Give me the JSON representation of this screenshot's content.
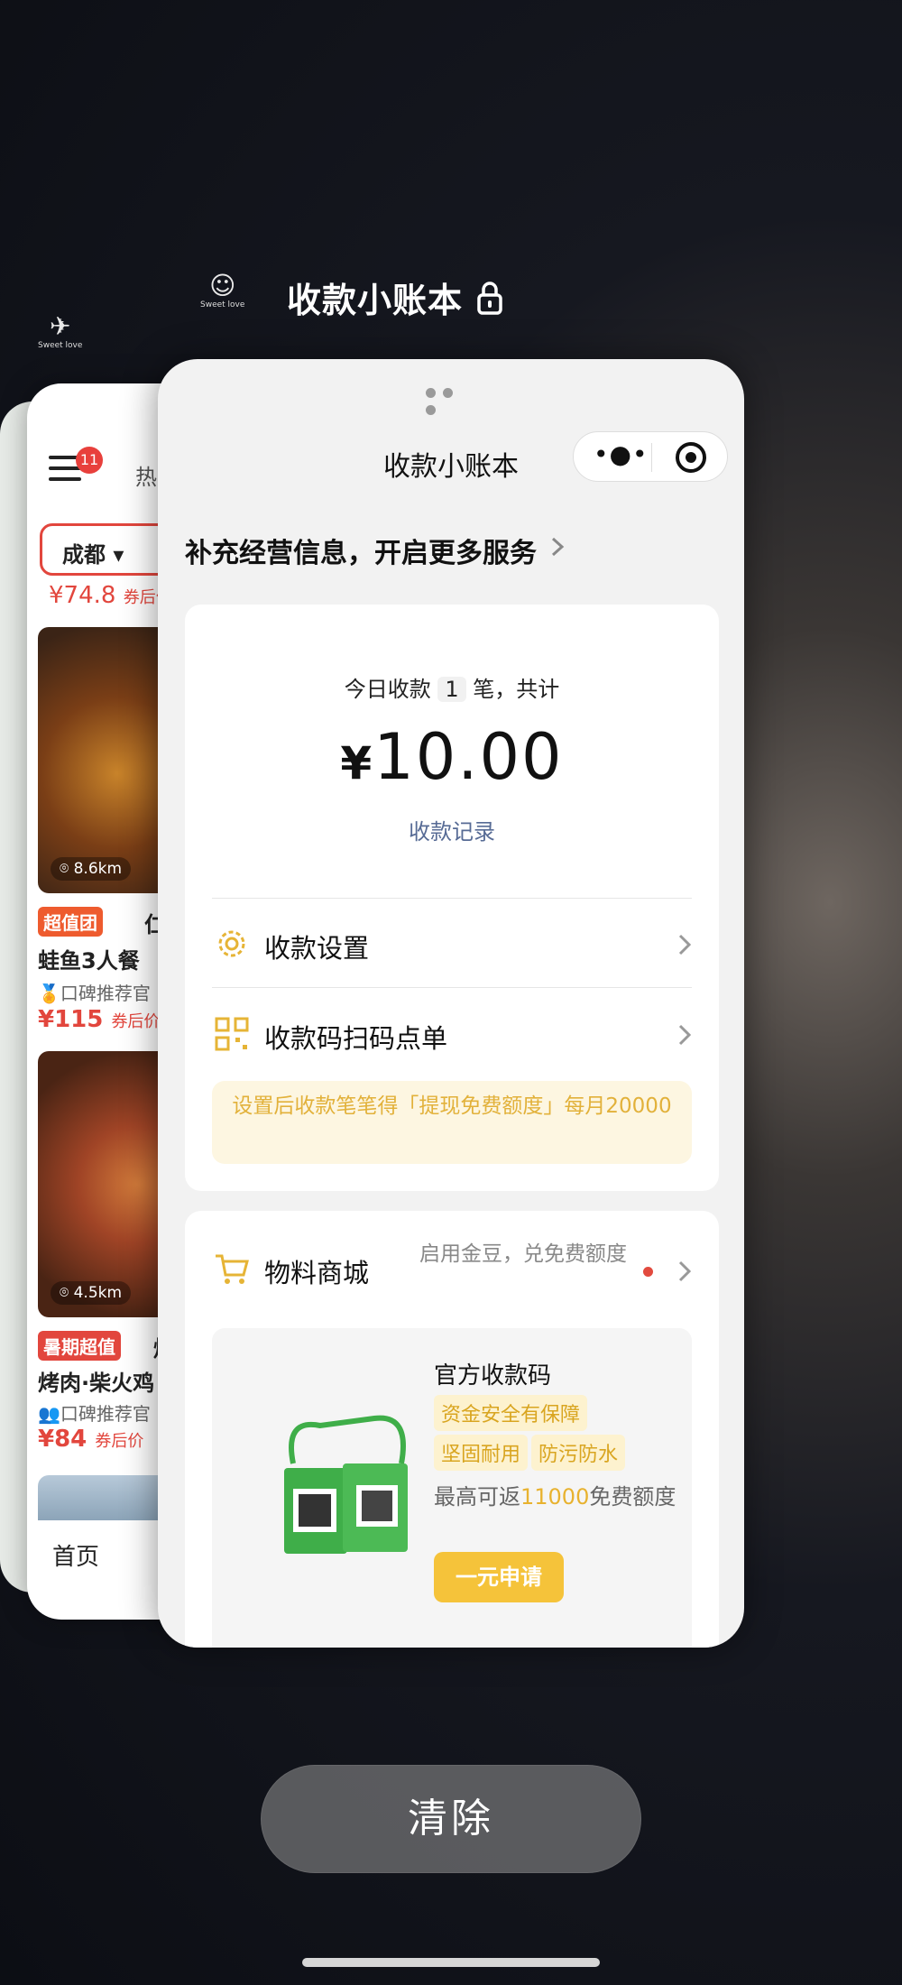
{
  "switcher": {
    "window_title": "收款小账本",
    "clear_label": "清除",
    "app_icons": [
      {
        "name": "tiktok-app-icon",
        "caption": "Sweet love"
      },
      {
        "name": "wechat-app-icon",
        "caption": "Sweet love"
      }
    ]
  },
  "background_app": {
    "badge_count": "11",
    "hot_label": "热",
    "city": "成都",
    "top_price": "¥74.8",
    "top_price_suffix": "券后价",
    "items": [
      {
        "distance": "8.6km",
        "tag": "超值团",
        "shop": "仁义",
        "title": "蛙鱼3人餐",
        "rec": "口碑推荐官",
        "price": "¥115",
        "price_suffix": "券后价"
      },
      {
        "distance": "4.5km",
        "tag": "暑期超值",
        "shop": "焰",
        "title": "烤肉·柴火鸡",
        "rec": "口碑推荐官",
        "price": "¥84",
        "price_suffix": "券后价"
      }
    ],
    "tab_home": "首页"
  },
  "mini_program": {
    "nav_title": "收款小账本",
    "promo": "补充经营信息，开启更多服务",
    "summary": {
      "prefix": "今日收款",
      "count": "1",
      "suffix": "笔，共计",
      "currency": "¥",
      "amount": "10.00",
      "records_link": "收款记录"
    },
    "menu": [
      {
        "label": "收款设置"
      },
      {
        "label": "收款码扫码点单"
      }
    ],
    "notice": "设置后收款笔笔得「提现免费额度」每月20000",
    "mall": {
      "label": "物料商城",
      "hint": "启用金豆，兑免费额度"
    },
    "product": {
      "title": "官方收款码",
      "chips": [
        "资金安全有保障",
        "坚固耐用",
        "防污防水"
      ],
      "desc_prefix": "最高可返",
      "desc_highlight": "11000",
      "desc_suffix": "免费额度",
      "apply_label": "一元申请"
    }
  },
  "colors": {
    "accent_yellow": "#f5c33a",
    "link_blue": "#576b95",
    "brand_red": "#e2463d"
  }
}
